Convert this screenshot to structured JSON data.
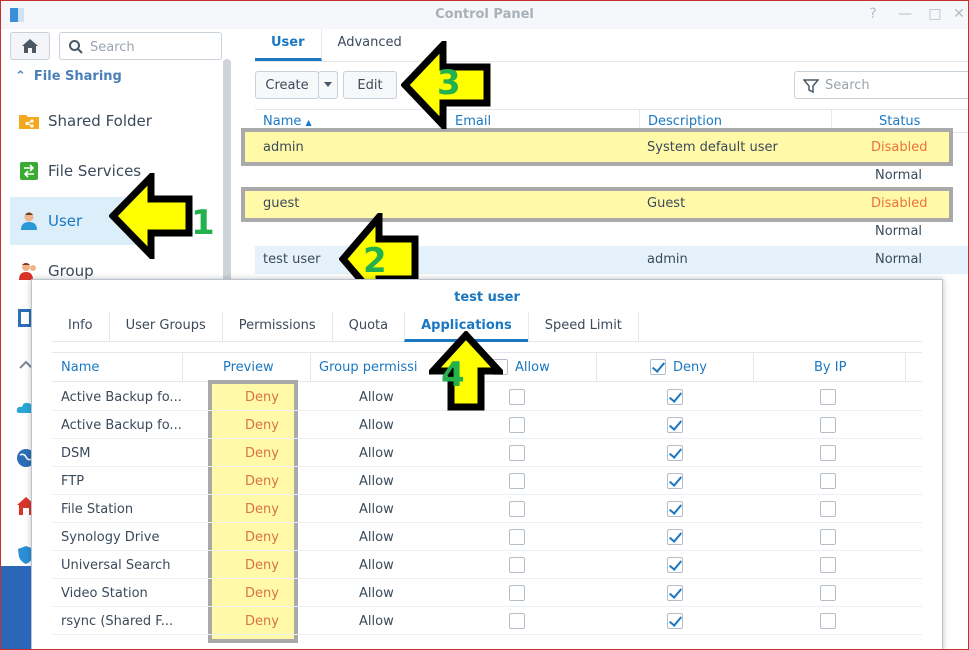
{
  "window": {
    "title": "Control Panel"
  },
  "sidebar": {
    "search_placeholder": "Search",
    "section_label": "File Sharing",
    "items": [
      {
        "label": "Shared Folder",
        "icon": "folder-share-icon"
      },
      {
        "label": "File Services",
        "icon": "file-services-icon"
      },
      {
        "label": "User",
        "icon": "user-icon"
      },
      {
        "label": "Group",
        "icon": "group-icon"
      }
    ]
  },
  "main": {
    "tabs": [
      {
        "label": "User"
      },
      {
        "label": "Advanced"
      }
    ],
    "toolbar": {
      "create_label": "Create",
      "edit_label": "Edit",
      "search_placeholder": "Search"
    },
    "columns": [
      "Name",
      "Email",
      "Description",
      "Status"
    ],
    "rows": [
      {
        "name": "admin",
        "email": "",
        "description": "System default user",
        "status": "Disabled"
      },
      {
        "name": "",
        "email": "",
        "description": "",
        "status": "Normal"
      },
      {
        "name": "guest",
        "email": "",
        "description": "Guest",
        "status": "Disabled"
      },
      {
        "name": "",
        "email": "",
        "description": "",
        "status": "Normal"
      },
      {
        "name": "test user",
        "email": "",
        "description": "admin",
        "status": "Normal"
      }
    ]
  },
  "annotations": [
    "1",
    "2",
    "3",
    "4"
  ],
  "dialog": {
    "title": "test user",
    "tabs": [
      "Info",
      "User Groups",
      "Permissions",
      "Quota",
      "Applications",
      "Speed Limit"
    ],
    "active_tab": "Applications",
    "columns": [
      "Name",
      "Preview",
      "Group permissi",
      "Allow",
      "Deny",
      "By IP"
    ],
    "rows": [
      {
        "name": "Active Backup fo...",
        "preview": "Deny",
        "group": "Allow",
        "allow": false,
        "deny": true,
        "byip": false
      },
      {
        "name": "Active Backup fo...",
        "preview": "Deny",
        "group": "Allow",
        "allow": false,
        "deny": true,
        "byip": false
      },
      {
        "name": "DSM",
        "preview": "Deny",
        "group": "Allow",
        "allow": false,
        "deny": true,
        "byip": false
      },
      {
        "name": "FTP",
        "preview": "Deny",
        "group": "Allow",
        "allow": false,
        "deny": true,
        "byip": false
      },
      {
        "name": "File Station",
        "preview": "Deny",
        "group": "Allow",
        "allow": false,
        "deny": true,
        "byip": false
      },
      {
        "name": "Synology Drive",
        "preview": "Deny",
        "group": "Allow",
        "allow": false,
        "deny": true,
        "byip": false
      },
      {
        "name": "Universal Search",
        "preview": "Deny",
        "group": "Allow",
        "allow": false,
        "deny": true,
        "byip": false
      },
      {
        "name": "Video Station",
        "preview": "Deny",
        "group": "Allow",
        "allow": false,
        "deny": true,
        "byip": false
      },
      {
        "name": "rsync (Shared F...",
        "preview": "Deny",
        "group": "Allow",
        "allow": false,
        "deny": true,
        "byip": false
      }
    ]
  },
  "colors": {
    "accent": "#1a78c2",
    "disabled_status": "#e8743b",
    "highlight": "#fff9a8",
    "arrow_fill": "#ffff00",
    "number_color": "#22b14c"
  }
}
